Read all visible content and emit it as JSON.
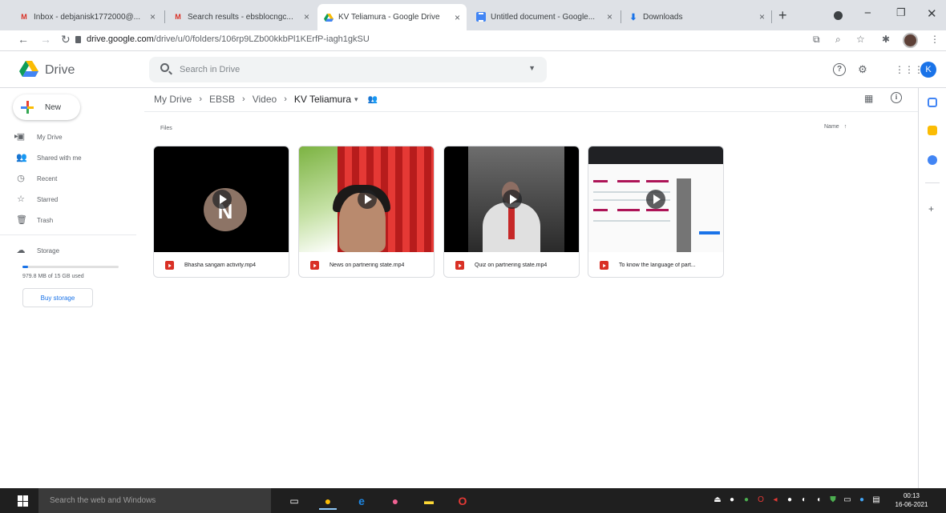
{
  "browser": {
    "tabs": [
      {
        "title": "Inbox - debjanisk1772000@...",
        "icon": "gmail-icon"
      },
      {
        "title": "Search results - ebsblocngc...",
        "icon": "gmail-icon"
      },
      {
        "title": "KV Teliamura - Google Drive",
        "icon": "drive-icon"
      },
      {
        "title": "Untitled document - Google...",
        "icon": "docs-icon"
      },
      {
        "title": "Downloads",
        "icon": "download-icon"
      }
    ],
    "url_host": "drive.google.com",
    "url_path": "/drive/u/0/folders/106rp9LZb00kkbPl1KErfP-iagh1gkSU"
  },
  "drive": {
    "app_name": "Drive",
    "search_placeholder": "Search in Drive",
    "account_initial": "K"
  },
  "sidebar": {
    "new_label": "New",
    "items": [
      {
        "label": "My Drive",
        "icon": "my-drive-icon"
      },
      {
        "label": "Shared with me",
        "icon": "shared-icon"
      },
      {
        "label": "Recent",
        "icon": "clock-icon"
      },
      {
        "label": "Starred",
        "icon": "star-icon"
      },
      {
        "label": "Trash",
        "icon": "trash-icon"
      }
    ],
    "storage_label": "Storage",
    "storage_used_fraction": 0.06,
    "storage_text": "979.8 MB of 15 GB used",
    "buy_storage_label": "Buy storage"
  },
  "breadcrumb": [
    "My Drive",
    "EBSB",
    "Video",
    "KV Teliamura"
  ],
  "files_label": "Files",
  "sort_label": "Name",
  "files": [
    {
      "name": "Bhasha sangam activity.mp4",
      "thumb": "logo"
    },
    {
      "name": "News on partnering state.mp4",
      "thumb": "boy"
    },
    {
      "name": "Quiz on partnering state.mp4",
      "thumb": "man"
    },
    {
      "name": "To know the language of part...",
      "thumb": "screen"
    }
  ],
  "taskbar": {
    "search_placeholder": "Search the web and Windows",
    "time": "00:13",
    "date": "16-06-2021"
  },
  "colors": {
    "accent": "#1a73e8",
    "video_icon": "#d93025",
    "taskbar": "#1f1f1f"
  }
}
